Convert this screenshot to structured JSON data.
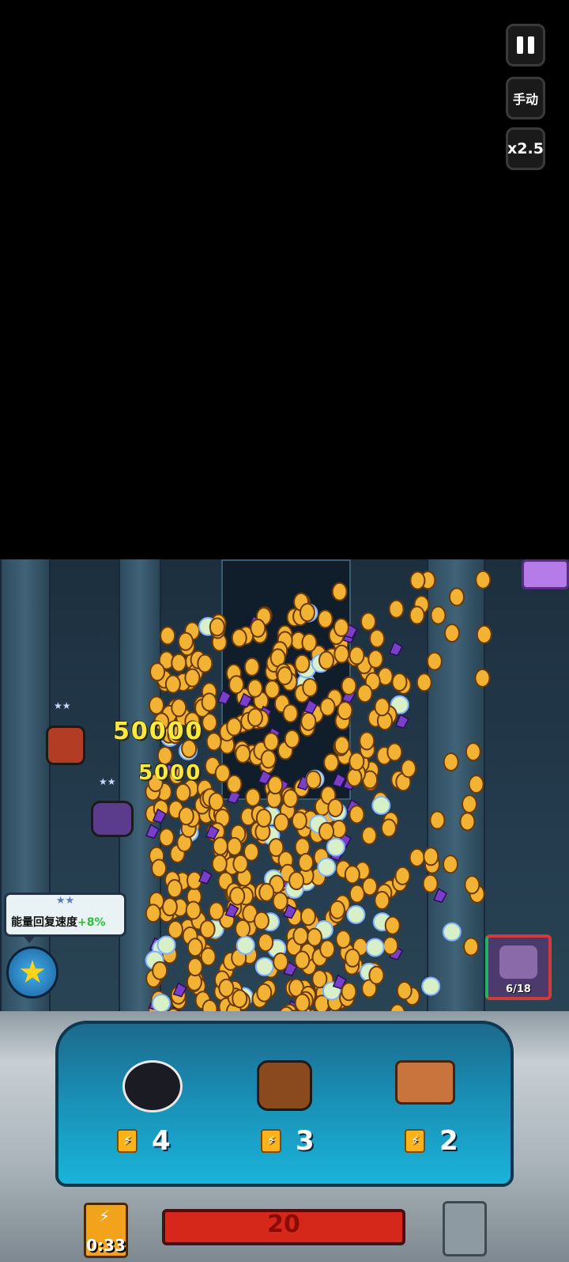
{
  "controls": {
    "mode_label": "手动",
    "speed_label": "x2.5"
  },
  "damage_numbers": [
    "50000",
    "5000"
  ],
  "buff": {
    "stars": "★★",
    "label": "能量回复速度",
    "value": "+8%"
  },
  "wave": {
    "count": "6/18"
  },
  "deck": [
    {
      "cost": "4"
    },
    {
      "cost": "3"
    },
    {
      "cost": "2"
    }
  ],
  "energy": {
    "timer": "0:33"
  },
  "hp": {
    "value": "20"
  },
  "colors": {
    "coin": "#f2b233",
    "gem": "#7a3fc8",
    "hp_bar": "#d6271b",
    "buff_value": "#2bbf3a"
  }
}
